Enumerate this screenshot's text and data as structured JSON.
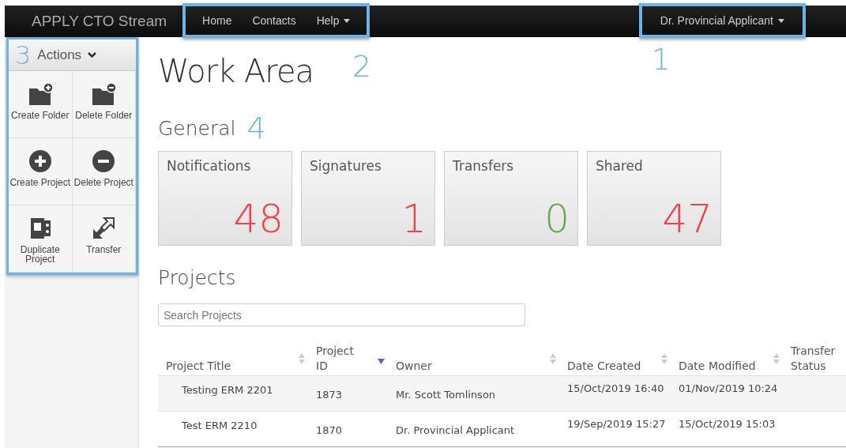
{
  "navbar": {
    "brand": "APPLY CTO Stream",
    "links": [
      {
        "label": "Home",
        "dropdown": false
      },
      {
        "label": "Contacts",
        "dropdown": false
      },
      {
        "label": "Help",
        "dropdown": true
      }
    ],
    "links_callout": "2",
    "user": {
      "label": "Dr. Provincial Applicant",
      "callout": "1"
    }
  },
  "sidebar": {
    "callout": "3",
    "title": "Actions",
    "actions": [
      {
        "kind": "folder-plus",
        "label": "Create Folder"
      },
      {
        "kind": "folder-minus",
        "label": "Delete Folder"
      },
      {
        "kind": "circle-plus",
        "label": "Create Project"
      },
      {
        "kind": "circle-minus",
        "label": "Delete Project"
      },
      {
        "kind": "duplicate",
        "label": "Duplicate Project"
      },
      {
        "kind": "transfer",
        "label": "Transfer"
      }
    ]
  },
  "main": {
    "title": "Work Area",
    "general": {
      "heading": "General",
      "callout": "4",
      "tiles": [
        {
          "label": "Notifications",
          "count": "48",
          "color": "#f0404a"
        },
        {
          "label": "Signatures",
          "count": "1",
          "color": "#f0404a"
        },
        {
          "label": "Transfers",
          "count": "0",
          "color": "#6aa84f"
        },
        {
          "label": "Shared",
          "count": "47",
          "color": "#f0404a"
        }
      ]
    },
    "projects": {
      "heading": "Projects",
      "search": {
        "placeholder": "Search Projects"
      },
      "columns": [
        {
          "label": "Project Title",
          "sortable": true,
          "sorted": false
        },
        {
          "label": "Project ID",
          "sortable": true,
          "sorted": true
        },
        {
          "label": "Owner",
          "sortable": true,
          "sorted": false
        },
        {
          "label": "Date Created",
          "sortable": true,
          "sorted": false
        },
        {
          "label": "Date Modified",
          "sortable": true,
          "sorted": false
        },
        {
          "label": "Transfer Status",
          "sortable": false
        }
      ],
      "rows": [
        {
          "cells": [
            "Testing ERM 2201",
            "1873",
            "Mr. Scott Tomlinson",
            "15/Oct/2019 16:40",
            "01/Nov/2019 10:24"
          ]
        },
        {
          "cells": [
            "Test ERM 2210",
            "1870",
            "Dr. Provincial Applicant",
            "19/Sep/2019 15:27",
            "15/Oct/2019 15:03"
          ]
        }
      ]
    }
  }
}
